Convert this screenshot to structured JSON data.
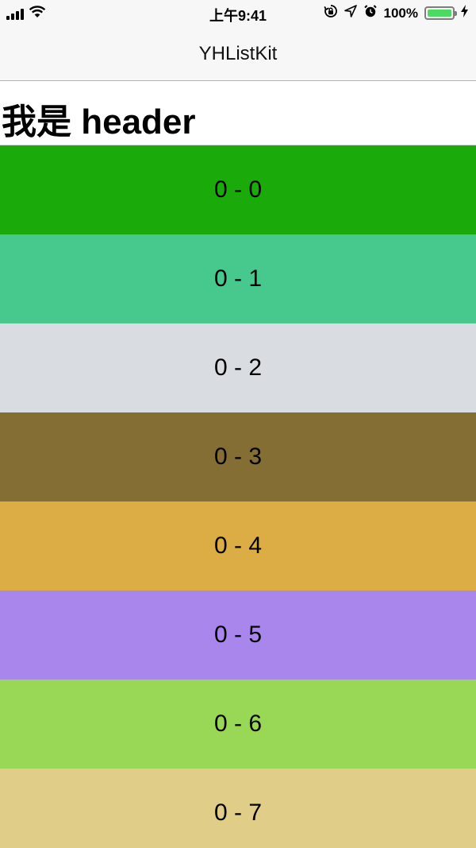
{
  "status_bar": {
    "time": "上午9:41",
    "battery_text": "100%",
    "battery_level": 1.0,
    "icons": [
      "signal-bars-icon",
      "wifi-icon",
      "rotation-lock-icon",
      "location-arrow-icon",
      "alarm-clock-icon",
      "battery-icon",
      "charging-bolt-icon"
    ]
  },
  "nav": {
    "title": "YHListKit"
  },
  "section": {
    "header": "我是 header"
  },
  "cells": [
    {
      "label": "0 - 0",
      "color": "#1aab0b"
    },
    {
      "label": "0 - 1",
      "color": "#47c98d"
    },
    {
      "label": "0 - 2",
      "color": "#d9dce0"
    },
    {
      "label": "0 - 3",
      "color": "#846e33"
    },
    {
      "label": "0 - 4",
      "color": "#dcad44"
    },
    {
      "label": "0 - 5",
      "color": "#a886ec"
    },
    {
      "label": "0 - 6",
      "color": "#98d856"
    },
    {
      "label": "0 - 7",
      "color": "#e0cd87"
    }
  ]
}
